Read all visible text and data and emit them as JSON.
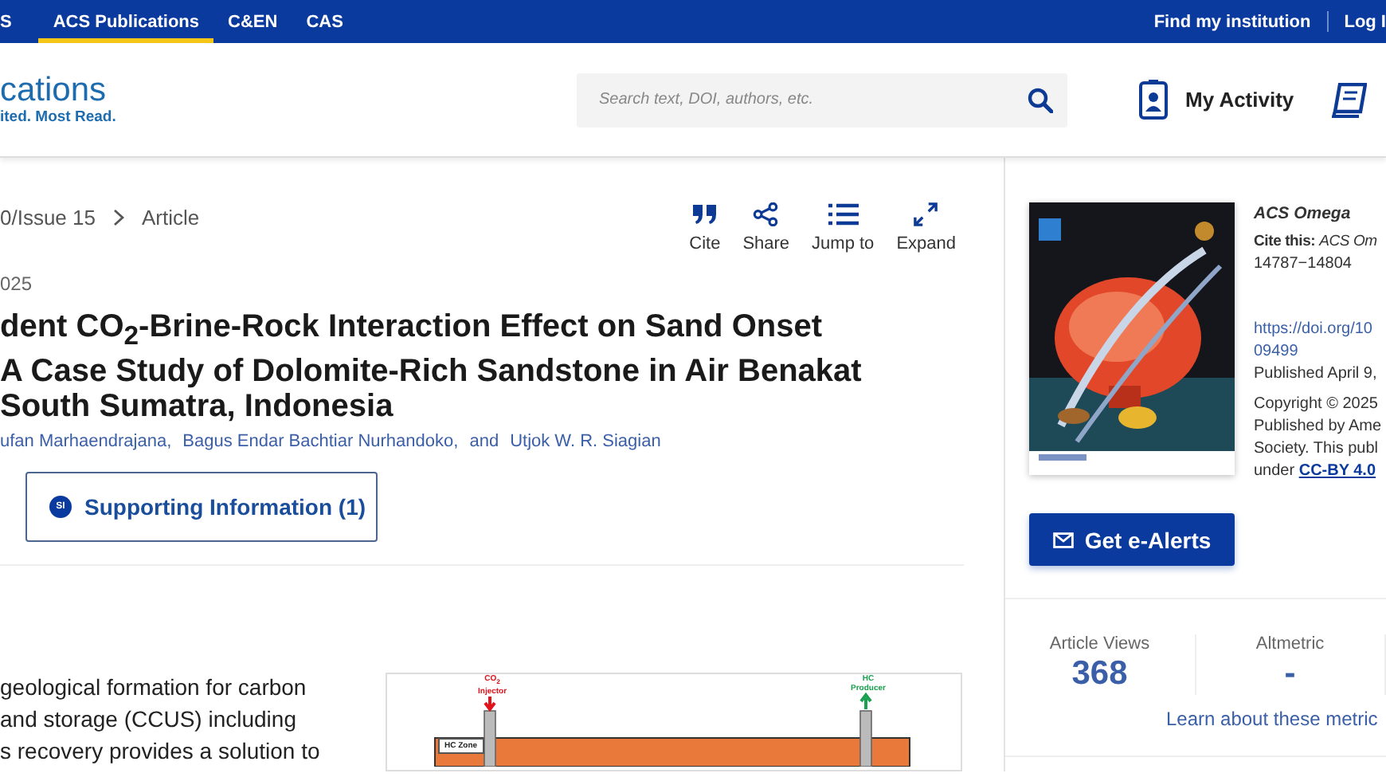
{
  "top_nav": {
    "items": [
      {
        "label": "S",
        "selected": false
      },
      {
        "label": "ACS Publications",
        "selected": true
      },
      {
        "label": "C&EN",
        "selected": false
      },
      {
        "label": "CAS",
        "selected": false
      }
    ],
    "right_links": [
      "Find my institution",
      "Log I"
    ]
  },
  "header": {
    "logo_name": "cations",
    "logo_tagline": "ited. Most Read.",
    "search": {
      "placeholder": "Search text, DOI, authors, etc."
    },
    "my_activity": "My Activity"
  },
  "breadcrumb": [
    "0/Issue 15",
    "Article"
  ],
  "actions": [
    {
      "label": "Cite",
      "kind": "cite"
    },
    {
      "label": "Share",
      "kind": "share"
    },
    {
      "label": "Jump to",
      "kind": "list"
    },
    {
      "label": "Expand",
      "kind": "expand"
    }
  ],
  "date": "025",
  "title_lines": [
    "dent CO$_{2}$-Brine-Rock Interaction Effect on Sand Onset",
    "A Case Study of Dolomite-Rich Sandstone in Air Benakat",
    "South Sumatra, Indonesia"
  ],
  "authors": [
    "ufan Marhaendrajana,",
    "Bagus Endar Bachtiar Nurhandoko,",
    "and",
    "Utjok W. R. Siagian"
  ],
  "supporting_info": {
    "badge": "SI",
    "label": "Supporting Information (1)"
  },
  "abstract_lines": [
    "geological formation for carbon",
    "and storage (CCUS) including",
    "s recovery provides a solution to"
  ],
  "figure": {
    "injector": "CO$_{2}$",
    "injector_label": "Injector",
    "producer": "HC",
    "producer_label": "Producer",
    "zone": "HC Zone"
  },
  "sidebar": {
    "cover": {
      "kind": "picture"
    },
    "journal": "ACS Omega",
    "cite_prefix": "Cite this:",
    "cite_journal": "ACS Om",
    "pages": "14787−14804",
    "doi_lines": [
      "https://doi.org/10",
      "09499"
    ],
    "published": "Published April 9,",
    "copyright_lines": [
      "Copyright © 2025",
      "Published by Ame",
      "Society. This publ"
    ],
    "license_prefix": "under",
    "license": "CC-BY 4.0",
    "alerts_button": "Get e-Alerts",
    "metrics": [
      {
        "label": "Article Views",
        "value": "368"
      },
      {
        "label": "Altmetric",
        "value": "-"
      }
    ],
    "metrics_link": "Learn about these metric"
  }
}
